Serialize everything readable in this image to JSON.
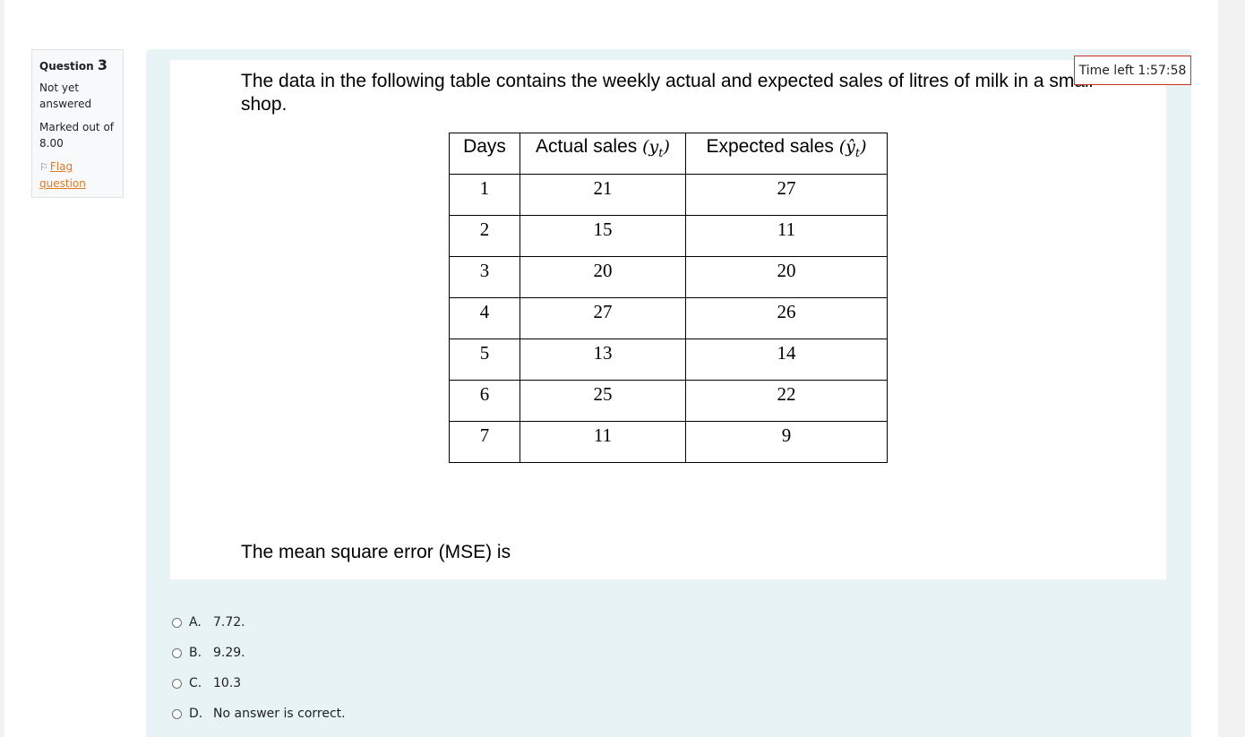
{
  "question_info": {
    "label": "Question",
    "number": "3",
    "state": "Not yet answered",
    "mark": "Marked out of 8.00",
    "flag_label": "Flag question"
  },
  "timer": {
    "text": "Time left 1:57:58"
  },
  "question": {
    "intro": "The data in the following table contains the weekly actual and expected sales of litres of milk in a small shop.",
    "prompt": "The mean square error (MSE) is"
  },
  "table": {
    "headers": {
      "days": "Days",
      "actual": "Actual sales",
      "actual_symbol": "y",
      "actual_sub": "t",
      "expected": "Expected sales",
      "expected_symbol": "ŷ",
      "expected_sub": "t"
    },
    "rows": [
      {
        "day": "1",
        "actual": "21",
        "expected": "27"
      },
      {
        "day": "2",
        "actual": "15",
        "expected": "11"
      },
      {
        "day": "3",
        "actual": "20",
        "expected": "20"
      },
      {
        "day": "4",
        "actual": "27",
        "expected": "26"
      },
      {
        "day": "5",
        "actual": "13",
        "expected": "14"
      },
      {
        "day": "6",
        "actual": "25",
        "expected": "22"
      },
      {
        "day": "7",
        "actual": "11",
        "expected": "9"
      }
    ]
  },
  "answers": [
    {
      "letter": "A.",
      "text": "7.72."
    },
    {
      "letter": "B.",
      "text": "9.29."
    },
    {
      "letter": "C.",
      "text": "10.3"
    },
    {
      "letter": "D.",
      "text": "No answer is correct."
    }
  ]
}
